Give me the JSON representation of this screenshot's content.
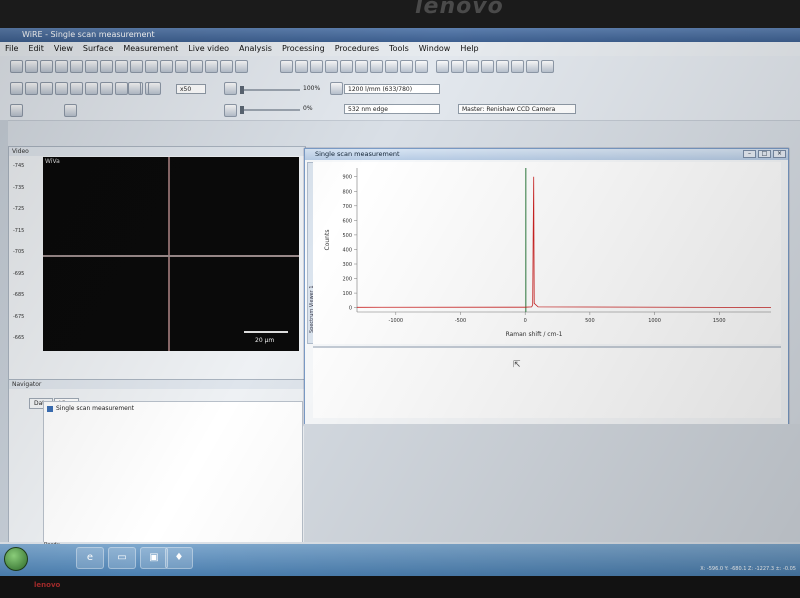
{
  "bezel": {
    "brand": "lenovo",
    "bottom_logo": "lenovo"
  },
  "window": {
    "title": "WiRE - Single scan measurement"
  },
  "menu": [
    "File",
    "Edit",
    "View",
    "Surface",
    "Measurement",
    "Live video",
    "Analysis",
    "Processing",
    "Procedures",
    "Tools",
    "Window",
    "Help"
  ],
  "toolbar": {
    "objective": "x50",
    "laser_power_pct": "100%",
    "grating": "1200 l/mm (633/780)",
    "second_pct": "0%",
    "laser": "532 nm edge",
    "camera": "Master: Renishaw CCD Camera"
  },
  "video": {
    "title": "Video",
    "tag": "WiVa",
    "scale_label": "20 µm",
    "y_ticks": [
      "-745",
      "-735",
      "-725",
      "-715",
      "-705",
      "-695",
      "-685",
      "-675",
      "-665"
    ]
  },
  "navigator": {
    "title": "Navigator",
    "tabs": [
      "Data",
      "View"
    ],
    "item": "Single scan measurement"
  },
  "spectrum_window": {
    "title": "Single scan measurement",
    "side_label": "Spectrum Viewer 1",
    "buttons": [
      "–",
      "□",
      "×"
    ]
  },
  "chart_data": {
    "type": "line",
    "title": "",
    "xlabel": "Raman shift / cm-1",
    "ylabel": "Counts",
    "xlim": [
      -1300,
      1900
    ],
    "ylim": [
      -30,
      960
    ],
    "x_ticks": [
      -1000,
      -500,
      0,
      500,
      1000,
      1500
    ],
    "y_ticks": [
      0,
      100,
      200,
      300,
      400,
      500,
      600,
      700,
      800,
      900
    ],
    "series": [
      {
        "color": "#cc2222",
        "x": [
          -1300,
          0,
          50,
          58,
          62,
          66,
          70,
          100,
          1900
        ],
        "y": [
          2,
          3,
          5,
          20,
          520,
          900,
          30,
          5,
          1
        ]
      }
    ],
    "markers": [
      {
        "x": 5,
        "color": "#2c7a3c"
      }
    ]
  },
  "status": {
    "left": "Ready",
    "coords": "X: -596.0  Y: -680.1  Z: -1227.3  ±: -0.05"
  },
  "taskbar": {
    "apps": [
      "ie",
      "folder",
      "media",
      "wire"
    ]
  }
}
